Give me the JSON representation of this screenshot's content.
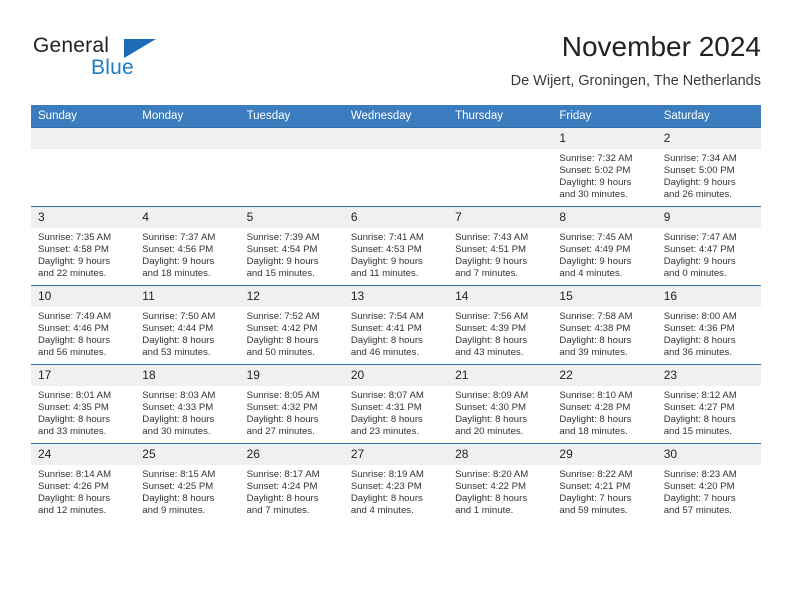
{
  "brand": {
    "name_part1": "General",
    "name_part2": "Blue",
    "triangle_color": "#1b6cb5",
    "blue_color": "#1f7cc4"
  },
  "header": {
    "title": "November 2024",
    "subtitle": "De Wijert, Groningen, The Netherlands"
  },
  "theme": {
    "header_row_color": "#3a7cbe",
    "daynum_background": "#f0f0f0",
    "text_color": "#333333"
  },
  "weekdays": [
    "Sunday",
    "Monday",
    "Tuesday",
    "Wednesday",
    "Thursday",
    "Friday",
    "Saturday"
  ],
  "weeks": [
    [
      {
        "day": "",
        "sunrise": "",
        "sunset": "",
        "daylight_line1": "",
        "daylight_line2": ""
      },
      {
        "day": "",
        "sunrise": "",
        "sunset": "",
        "daylight_line1": "",
        "daylight_line2": ""
      },
      {
        "day": "",
        "sunrise": "",
        "sunset": "",
        "daylight_line1": "",
        "daylight_line2": ""
      },
      {
        "day": "",
        "sunrise": "",
        "sunset": "",
        "daylight_line1": "",
        "daylight_line2": ""
      },
      {
        "day": "",
        "sunrise": "",
        "sunset": "",
        "daylight_line1": "",
        "daylight_line2": ""
      },
      {
        "day": "1",
        "sunrise": "Sunrise: 7:32 AM",
        "sunset": "Sunset: 5:02 PM",
        "daylight_line1": "Daylight: 9 hours",
        "daylight_line2": "and 30 minutes."
      },
      {
        "day": "2",
        "sunrise": "Sunrise: 7:34 AM",
        "sunset": "Sunset: 5:00 PM",
        "daylight_line1": "Daylight: 9 hours",
        "daylight_line2": "and 26 minutes."
      }
    ],
    [
      {
        "day": "3",
        "sunrise": "Sunrise: 7:35 AM",
        "sunset": "Sunset: 4:58 PM",
        "daylight_line1": "Daylight: 9 hours",
        "daylight_line2": "and 22 minutes."
      },
      {
        "day": "4",
        "sunrise": "Sunrise: 7:37 AM",
        "sunset": "Sunset: 4:56 PM",
        "daylight_line1": "Daylight: 9 hours",
        "daylight_line2": "and 18 minutes."
      },
      {
        "day": "5",
        "sunrise": "Sunrise: 7:39 AM",
        "sunset": "Sunset: 4:54 PM",
        "daylight_line1": "Daylight: 9 hours",
        "daylight_line2": "and 15 minutes."
      },
      {
        "day": "6",
        "sunrise": "Sunrise: 7:41 AM",
        "sunset": "Sunset: 4:53 PM",
        "daylight_line1": "Daylight: 9 hours",
        "daylight_line2": "and 11 minutes."
      },
      {
        "day": "7",
        "sunrise": "Sunrise: 7:43 AM",
        "sunset": "Sunset: 4:51 PM",
        "daylight_line1": "Daylight: 9 hours",
        "daylight_line2": "and 7 minutes."
      },
      {
        "day": "8",
        "sunrise": "Sunrise: 7:45 AM",
        "sunset": "Sunset: 4:49 PM",
        "daylight_line1": "Daylight: 9 hours",
        "daylight_line2": "and 4 minutes."
      },
      {
        "day": "9",
        "sunrise": "Sunrise: 7:47 AM",
        "sunset": "Sunset: 4:47 PM",
        "daylight_line1": "Daylight: 9 hours",
        "daylight_line2": "and 0 minutes."
      }
    ],
    [
      {
        "day": "10",
        "sunrise": "Sunrise: 7:49 AM",
        "sunset": "Sunset: 4:46 PM",
        "daylight_line1": "Daylight: 8 hours",
        "daylight_line2": "and 56 minutes."
      },
      {
        "day": "11",
        "sunrise": "Sunrise: 7:50 AM",
        "sunset": "Sunset: 4:44 PM",
        "daylight_line1": "Daylight: 8 hours",
        "daylight_line2": "and 53 minutes."
      },
      {
        "day": "12",
        "sunrise": "Sunrise: 7:52 AM",
        "sunset": "Sunset: 4:42 PM",
        "daylight_line1": "Daylight: 8 hours",
        "daylight_line2": "and 50 minutes."
      },
      {
        "day": "13",
        "sunrise": "Sunrise: 7:54 AM",
        "sunset": "Sunset: 4:41 PM",
        "daylight_line1": "Daylight: 8 hours",
        "daylight_line2": "and 46 minutes."
      },
      {
        "day": "14",
        "sunrise": "Sunrise: 7:56 AM",
        "sunset": "Sunset: 4:39 PM",
        "daylight_line1": "Daylight: 8 hours",
        "daylight_line2": "and 43 minutes."
      },
      {
        "day": "15",
        "sunrise": "Sunrise: 7:58 AM",
        "sunset": "Sunset: 4:38 PM",
        "daylight_line1": "Daylight: 8 hours",
        "daylight_line2": "and 39 minutes."
      },
      {
        "day": "16",
        "sunrise": "Sunrise: 8:00 AM",
        "sunset": "Sunset: 4:36 PM",
        "daylight_line1": "Daylight: 8 hours",
        "daylight_line2": "and 36 minutes."
      }
    ],
    [
      {
        "day": "17",
        "sunrise": "Sunrise: 8:01 AM",
        "sunset": "Sunset: 4:35 PM",
        "daylight_line1": "Daylight: 8 hours",
        "daylight_line2": "and 33 minutes."
      },
      {
        "day": "18",
        "sunrise": "Sunrise: 8:03 AM",
        "sunset": "Sunset: 4:33 PM",
        "daylight_line1": "Daylight: 8 hours",
        "daylight_line2": "and 30 minutes."
      },
      {
        "day": "19",
        "sunrise": "Sunrise: 8:05 AM",
        "sunset": "Sunset: 4:32 PM",
        "daylight_line1": "Daylight: 8 hours",
        "daylight_line2": "and 27 minutes."
      },
      {
        "day": "20",
        "sunrise": "Sunrise: 8:07 AM",
        "sunset": "Sunset: 4:31 PM",
        "daylight_line1": "Daylight: 8 hours",
        "daylight_line2": "and 23 minutes."
      },
      {
        "day": "21",
        "sunrise": "Sunrise: 8:09 AM",
        "sunset": "Sunset: 4:30 PM",
        "daylight_line1": "Daylight: 8 hours",
        "daylight_line2": "and 20 minutes."
      },
      {
        "day": "22",
        "sunrise": "Sunrise: 8:10 AM",
        "sunset": "Sunset: 4:28 PM",
        "daylight_line1": "Daylight: 8 hours",
        "daylight_line2": "and 18 minutes."
      },
      {
        "day": "23",
        "sunrise": "Sunrise: 8:12 AM",
        "sunset": "Sunset: 4:27 PM",
        "daylight_line1": "Daylight: 8 hours",
        "daylight_line2": "and 15 minutes."
      }
    ],
    [
      {
        "day": "24",
        "sunrise": "Sunrise: 8:14 AM",
        "sunset": "Sunset: 4:26 PM",
        "daylight_line1": "Daylight: 8 hours",
        "daylight_line2": "and 12 minutes."
      },
      {
        "day": "25",
        "sunrise": "Sunrise: 8:15 AM",
        "sunset": "Sunset: 4:25 PM",
        "daylight_line1": "Daylight: 8 hours",
        "daylight_line2": "and 9 minutes."
      },
      {
        "day": "26",
        "sunrise": "Sunrise: 8:17 AM",
        "sunset": "Sunset: 4:24 PM",
        "daylight_line1": "Daylight: 8 hours",
        "daylight_line2": "and 7 minutes."
      },
      {
        "day": "27",
        "sunrise": "Sunrise: 8:19 AM",
        "sunset": "Sunset: 4:23 PM",
        "daylight_line1": "Daylight: 8 hours",
        "daylight_line2": "and 4 minutes."
      },
      {
        "day": "28",
        "sunrise": "Sunrise: 8:20 AM",
        "sunset": "Sunset: 4:22 PM",
        "daylight_line1": "Daylight: 8 hours",
        "daylight_line2": "and 1 minute."
      },
      {
        "day": "29",
        "sunrise": "Sunrise: 8:22 AM",
        "sunset": "Sunset: 4:21 PM",
        "daylight_line1": "Daylight: 7 hours",
        "daylight_line2": "and 59 minutes."
      },
      {
        "day": "30",
        "sunrise": "Sunrise: 8:23 AM",
        "sunset": "Sunset: 4:20 PM",
        "daylight_line1": "Daylight: 7 hours",
        "daylight_line2": "and 57 minutes."
      }
    ]
  ]
}
